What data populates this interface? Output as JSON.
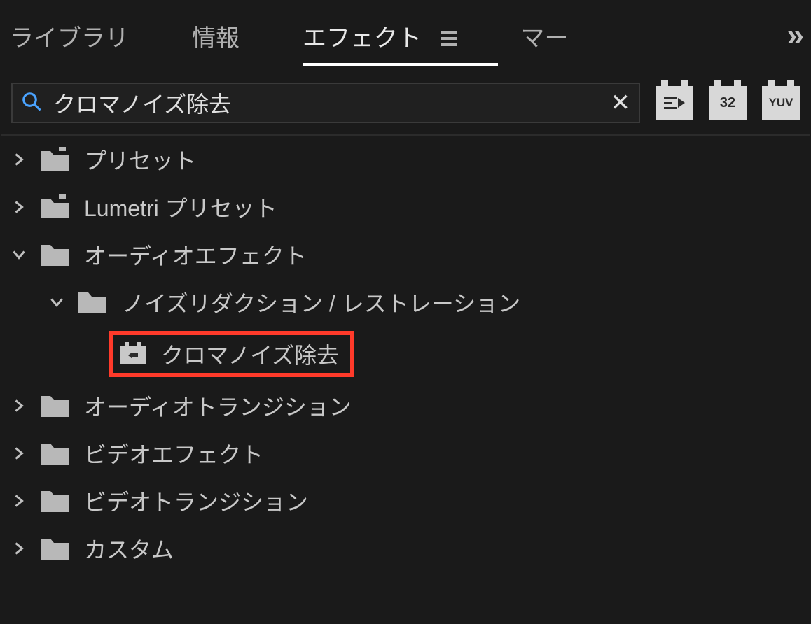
{
  "tabs": {
    "library": "ライブラリ",
    "info": "情報",
    "effects": "エフェクト",
    "markers_truncated": "マー"
  },
  "search": {
    "value": "クロマノイズ除去"
  },
  "badges": {
    "b32": "32",
    "byuv": "YUV"
  },
  "tree": {
    "presets": "プリセット",
    "lumetri": "Lumetri プリセット",
    "audio_fx": "オーディオエフェクト",
    "noise_reduction": "ノイズリダクション / レストレーション",
    "chroma_denoise": "クロマノイズ除去",
    "audio_trans": "オーディオトランジション",
    "video_fx": "ビデオエフェクト",
    "video_trans": "ビデオトランジション",
    "custom": "カスタム"
  }
}
